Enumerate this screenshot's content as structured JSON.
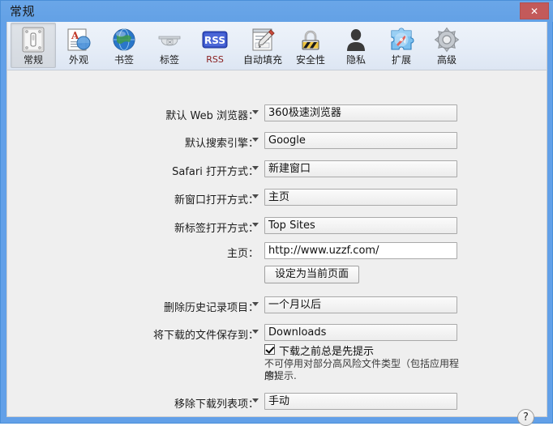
{
  "window": {
    "title": "常规",
    "close_label": "✕",
    "accent_blue": "#62a0e8",
    "close_red": "#c35a5a",
    "client_bg": "#efefef"
  },
  "toolbar": {
    "items": [
      {
        "label": "常规",
        "icon": "switch-plate-icon",
        "selected": true
      },
      {
        "label": "外观",
        "icon": "appearance-icon",
        "selected": false
      },
      {
        "label": "书签",
        "icon": "globe-icon",
        "selected": false
      },
      {
        "label": "标签",
        "icon": "tab-icon",
        "selected": false
      },
      {
        "label": "RSS",
        "icon": "rss-icon",
        "selected": false
      },
      {
        "label": "自动填充",
        "icon": "autofill-icon",
        "selected": false
      },
      {
        "label": "安全性",
        "icon": "padlock-icon",
        "selected": false
      },
      {
        "label": "隐私",
        "icon": "person-icon",
        "selected": false
      },
      {
        "label": "扩展",
        "icon": "puzzle-icon",
        "selected": false
      },
      {
        "label": "高级",
        "icon": "gear-icon",
        "selected": false
      }
    ]
  },
  "form": {
    "default_browser": {
      "label": "默认 Web 浏览器：",
      "value": "360极速浏览器",
      "options": [
        "360极速浏览器"
      ]
    },
    "default_search": {
      "label": "默认搜索引擎：",
      "value": "Google",
      "options": [
        "Google"
      ]
    },
    "safari_open": {
      "label": "Safari 打开方式：",
      "value": "新建窗口",
      "options": [
        "新建窗口"
      ]
    },
    "new_window_open": {
      "label": "新窗口打开方式：",
      "value": "主页",
      "options": [
        "主页"
      ]
    },
    "new_tab_open": {
      "label": "新标签打开方式：",
      "value": "Top Sites",
      "options": [
        "Top Sites"
      ]
    },
    "homepage": {
      "label": "主页：",
      "value": "http://www.uzzf.com/",
      "placeholder": ""
    },
    "set_current_page": {
      "label": "设定为当前页面"
    },
    "remove_history": {
      "label": "删除历史记录项目：",
      "value": "一个月以后",
      "options": [
        "一个月以后"
      ]
    },
    "save_downloads_to": {
      "label": "将下载的文件保存到：",
      "value": "Downloads",
      "options": [
        "Downloads"
      ]
    },
    "always_prompt": {
      "label": "下载之前总是先提示",
      "checked": true
    },
    "prompt_hint": {
      "line1": "不可停用对部分高风险文件类型（包括应用程序）",
      "line2": "的提示."
    },
    "remove_download_items": {
      "label": "移除下载列表项：",
      "value": "手动",
      "options": [
        "手动"
      ]
    }
  },
  "help": {
    "label": "?"
  }
}
